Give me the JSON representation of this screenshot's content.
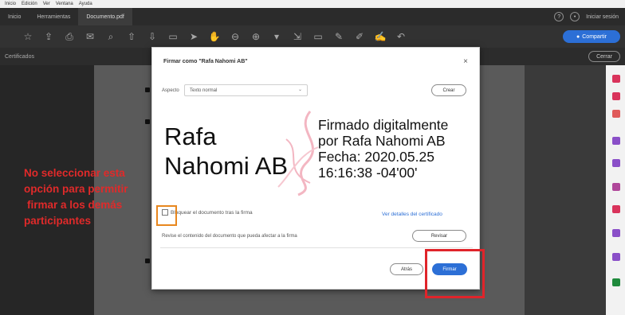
{
  "menubar": {
    "items": [
      "Inicio",
      "Edición",
      "Ver",
      "Ventana",
      "Ayuda"
    ]
  },
  "tabs": {
    "items": [
      "Inicio",
      "Herramientas",
      "Documento.pdf"
    ],
    "active_index": 2,
    "help_icon": "question-icon",
    "signin_label": "Iniciar sesión"
  },
  "toolbar": {
    "share_label": "Compartir",
    "icons": [
      "star-icon",
      "upload-icon",
      "print-icon",
      "mail-icon",
      "search-icon",
      "arrow-up-icon",
      "arrow-down-icon",
      "page-indicator",
      "cursor-icon",
      "hand-icon",
      "zoom-out-icon",
      "zoom-in-icon",
      "zoom-dropdown",
      "fit-icon",
      "comment-icon",
      "pen-icon",
      "highlight-icon",
      "sign-icon",
      "undo-icon"
    ]
  },
  "subbar": {
    "label": "Certificados",
    "close_label": "Cerrar"
  },
  "dialog": {
    "title": "Firmar como \"Rafa Nahomi AB\"",
    "close_symbol": "×",
    "aspect_label": "Aspecto",
    "aspect_value": "Texto normal",
    "create_label": "Crear",
    "signature": {
      "name_line1": "Rafa",
      "name_line2": "Nahomi AB",
      "details_line1": "Firmado digitalmente",
      "details_line2": "por Rafa Nahomi AB",
      "details_line3": "Fecha: 2020.05.25",
      "details_line4": "16:16:38 -04'00'"
    },
    "lock_label": "Bloquear el documento tras la firma",
    "lock_checked": false,
    "cert_link": "Ver detalles del certificado",
    "review_text": "Revise el contenido del documento que pueda afectar a la firma",
    "review_label": "Revisar",
    "back_label": "Atrás",
    "sign_label": "Firmar"
  },
  "annotation": {
    "line1": "No seleccionar esta",
    "line2": "opción para permitir",
    "line3": "firmar a los demás",
    "line4": "participantes",
    "color": "#e02a2a"
  },
  "colors": {
    "accent": "#2c6fd6",
    "highlight_orange": "#e8871e",
    "highlight_red": "#e0242a"
  }
}
